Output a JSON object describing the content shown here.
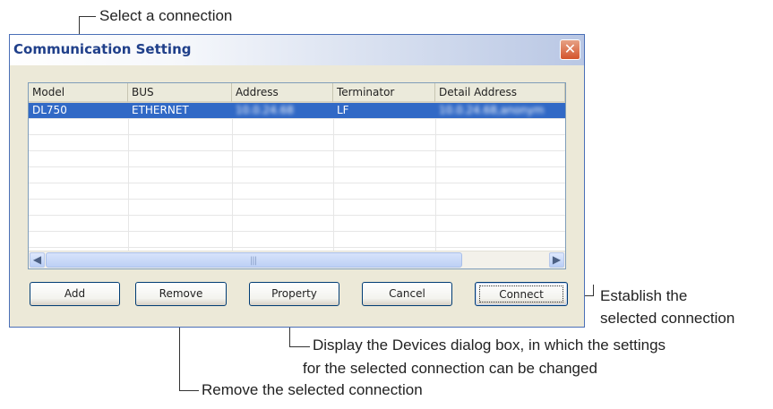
{
  "annotations": {
    "select": "Select a connection",
    "establish_line1": "Establish the",
    "establish_line2": "selected connection",
    "display_line1": "Display the Devices dialog box, in which the settings",
    "display_line2": "for the selected connection can be changed",
    "remove": "Remove the selected connection"
  },
  "window": {
    "title": "Communication Setting",
    "close_glyph": "✕"
  },
  "list": {
    "columns": [
      "Model",
      "BUS",
      "Address",
      "Terminator",
      "Detail Address"
    ],
    "rows": [
      {
        "model": "DL750",
        "bus": "ETHERNET",
        "address": "10.0.24.68",
        "terminator": "LF",
        "detail": "10.0.24.68,anonym",
        "selected": true
      }
    ],
    "scroll_grip": "|||"
  },
  "buttons": {
    "add": "Add",
    "remove": "Remove",
    "property": "Property",
    "cancel": "Cancel",
    "connect": "Connect"
  },
  "colors": {
    "selection": "#3169c6",
    "title_text": "#1f3f8a",
    "close_red": "#d4542c"
  }
}
